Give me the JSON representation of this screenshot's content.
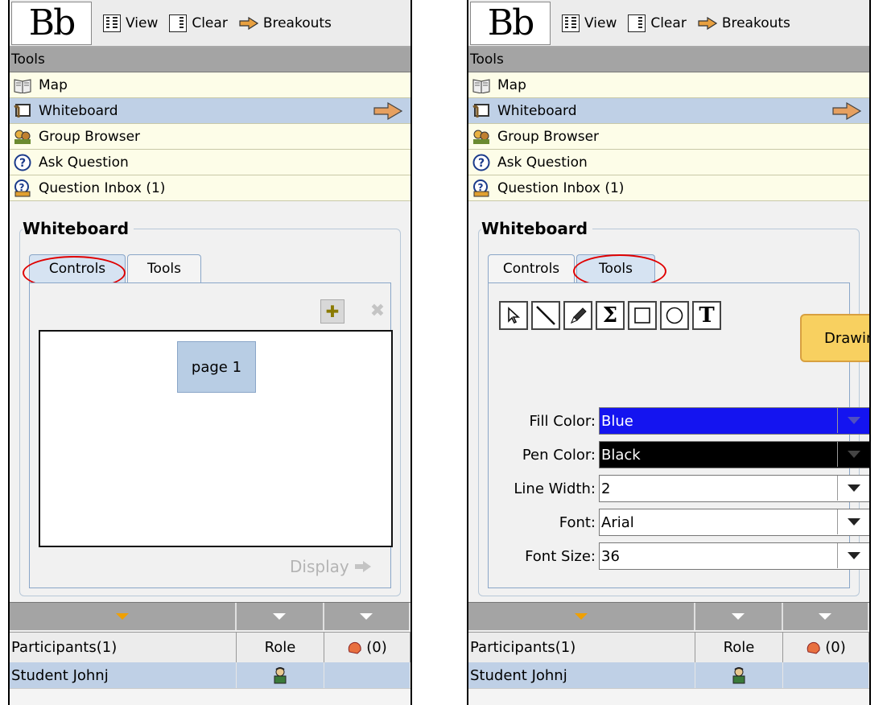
{
  "toolbar": {
    "logo": "Bb",
    "view_label": "View",
    "clear_label": "Clear",
    "breakouts_label": "Breakouts"
  },
  "tools": {
    "header": "Tools",
    "items": [
      {
        "label": "Map",
        "icon": "map-icon"
      },
      {
        "label": "Whiteboard",
        "icon": "whiteboard-icon"
      },
      {
        "label": "Group Browser",
        "icon": "group-browser-icon"
      },
      {
        "label": "Ask Question",
        "icon": "question-icon"
      },
      {
        "label": "Question Inbox (1)",
        "icon": "question-inbox-icon"
      }
    ]
  },
  "whiteboard": {
    "title": "Whiteboard",
    "tabs": [
      "Controls",
      "Tools"
    ],
    "page_label": "page 1",
    "display_label": "Display",
    "callout": "Drawing",
    "fields": [
      {
        "label": "Fill Color:",
        "value": "Blue",
        "color": "#1414f0"
      },
      {
        "label": "Pen Color:",
        "value": "Black",
        "color": "#000000"
      },
      {
        "label": "Line Width:",
        "value": "2"
      },
      {
        "label": "Font:",
        "value": "Arial"
      },
      {
        "label": "Font Size:",
        "value": "36"
      }
    ]
  },
  "participants": {
    "header": "Participants(1)",
    "role_header": "Role",
    "hand_count": "(0)",
    "rows": [
      {
        "name": "Student Johnj"
      }
    ]
  },
  "colors": {
    "selected": "#bfd0e6",
    "tool_bg": "#fdfde8",
    "header_bg": "#a4a4a4",
    "annotation": "#e00000"
  }
}
